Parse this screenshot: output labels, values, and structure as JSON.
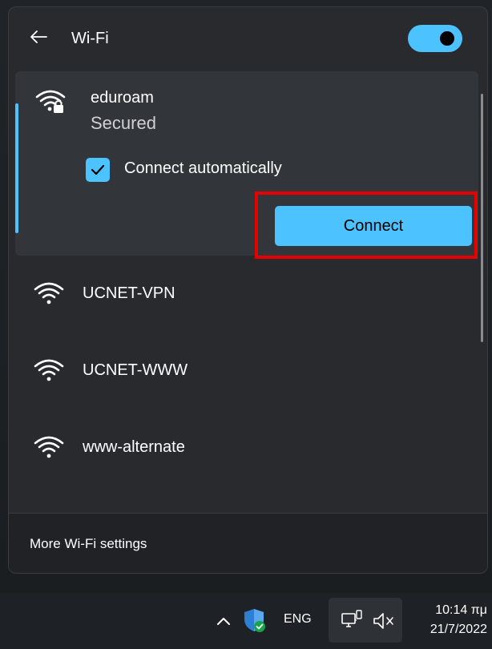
{
  "flyout": {
    "title": "Wi-Fi",
    "wifi_enabled": true,
    "networks": [
      {
        "ssid": "eduroam",
        "status": "Secured",
        "secured": true,
        "expanded": true,
        "connect_automatically_label": "Connect automatically",
        "connect_automatically_checked": true,
        "connect_label": "Connect"
      },
      {
        "ssid": "UCNET-VPN",
        "secured": false
      },
      {
        "ssid": "UCNET-WWW",
        "secured": false
      },
      {
        "ssid": "www-alternate",
        "secured": false
      }
    ],
    "more_settings_label": "More Wi-Fi settings"
  },
  "taskbar": {
    "language": "ENG",
    "time": "10:14 πμ",
    "date": "21/7/2022"
  },
  "colors": {
    "accent": "#4cc2ff",
    "highlight": "#e60000",
    "flyout_bg": "#282a2e",
    "expanded_bg": "#32353a"
  }
}
